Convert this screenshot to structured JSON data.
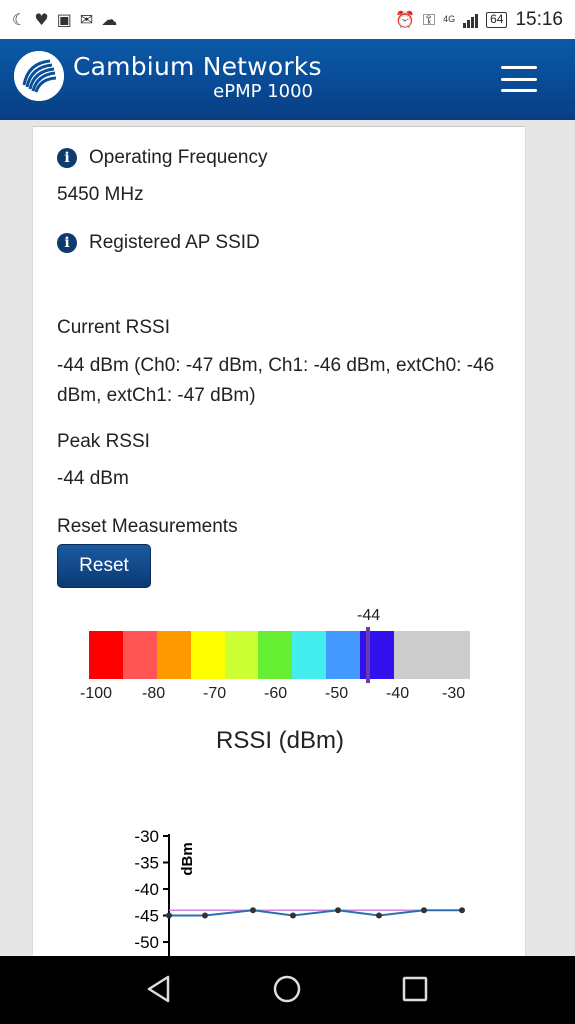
{
  "status_bar": {
    "time": "15:16",
    "battery": "64",
    "network": "4G",
    "left_icons": [
      "moon-icon",
      "heart-rate-icon",
      "photo-icon",
      "mail-icon",
      "cloud-icon"
    ],
    "right_icons": [
      "alarm-icon",
      "key-icon",
      "signal-icon"
    ]
  },
  "header": {
    "brand": "Cambium Networks",
    "model": "ePMP 1000",
    "colors": {
      "bar": "#0a4f9a",
      "text": "#ffffff"
    }
  },
  "fields": {
    "operating_frequency_label": "Operating Frequency",
    "operating_frequency_value": "5450 MHz",
    "registered_ap_ssid_label": "Registered AP SSID",
    "registered_ap_ssid_value": "",
    "current_rssi_label": "Current RSSI",
    "current_rssi_value": "-44 dBm (Ch0: -47 dBm, Ch1: -46 dBm, extCh0: -46 dBm, extCh1: -47 dBm)",
    "peak_rssi_label": "Peak RSSI",
    "peak_rssi_value": "-44 dBm",
    "reset_label": "Reset Measurements",
    "reset_button": "Reset"
  },
  "rssi_meter": {
    "current_value": "-44",
    "current_numeric": -44,
    "range": [
      -100,
      -30
    ],
    "tick_labels": [
      "-100",
      "-80",
      "-70",
      "-60",
      "-50",
      "-40",
      "-30"
    ],
    "title": "RSSI (dBm)",
    "segment_colors": [
      "#ff0000",
      "#ff5555",
      "#ff9900",
      "#ffff00",
      "#ccff33",
      "#66ee33",
      "#44eeee",
      "#4499ff",
      "#3311ee"
    ],
    "empty_color": "#cccccc",
    "marker_color": "#6a3ab0"
  },
  "chart_data": {
    "type": "line",
    "ylabel": "dBm",
    "y_ticks": [
      "-30",
      "-35",
      "-40",
      "-45",
      "-50"
    ],
    "ylim": [
      -52,
      -30
    ],
    "series": [
      {
        "values": [
          -45,
          -45,
          -44,
          -45,
          -44,
          -45,
          -44,
          -44
        ],
        "color": "#2a6fb0"
      }
    ],
    "reference_line": {
      "value": -44,
      "color": "#cc88dd"
    }
  },
  "nav": {
    "back": "back-icon",
    "home": "home-icon",
    "recents": "recents-icon"
  }
}
